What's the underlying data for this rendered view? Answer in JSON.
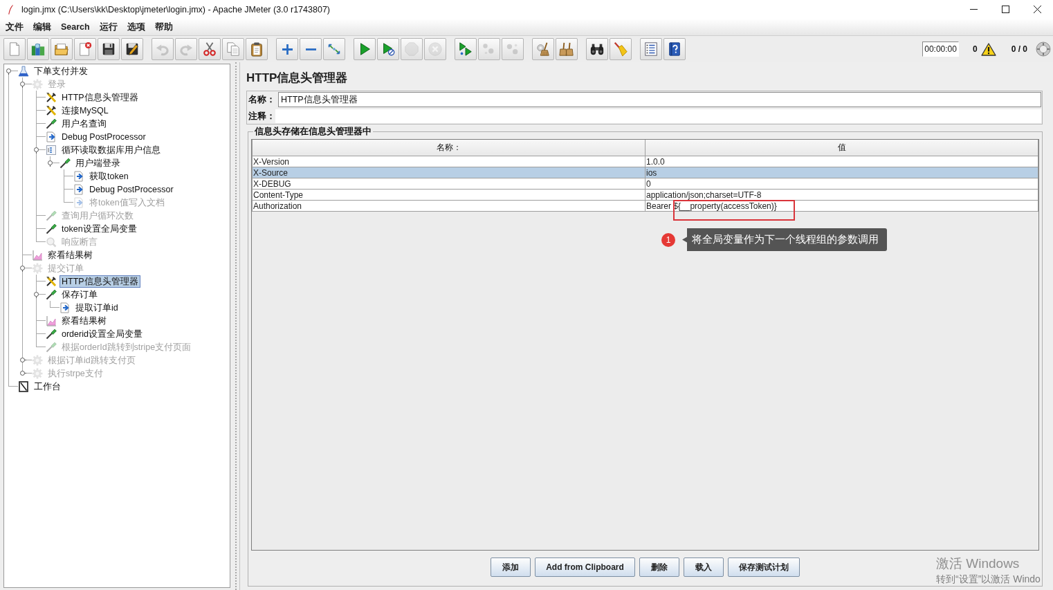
{
  "window": {
    "title": "login.jmx (C:\\Users\\kk\\Desktop\\jmeter\\login.jmx) - Apache JMeter (3.0 r1743807)"
  },
  "menu": [
    "文件",
    "编辑",
    "Search",
    "运行",
    "选项",
    "帮助"
  ],
  "toolbar": {
    "groups": [
      [
        {
          "kind": "new",
          "disabled": false
        },
        {
          "kind": "templates",
          "disabled": false
        },
        {
          "kind": "open",
          "disabled": false
        },
        {
          "kind": "close",
          "disabled": false
        },
        {
          "kind": "save",
          "disabled": false
        },
        {
          "kind": "save-as",
          "disabled": false
        }
      ],
      [
        {
          "kind": "undo",
          "disabled": true
        },
        {
          "kind": "redo",
          "disabled": true
        },
        {
          "kind": "cut",
          "disabled": false
        },
        {
          "kind": "copy",
          "disabled": false
        },
        {
          "kind": "paste",
          "disabled": false
        }
      ],
      [
        {
          "kind": "expand",
          "disabled": false
        },
        {
          "kind": "collapse",
          "disabled": false
        },
        {
          "kind": "toggle",
          "disabled": false
        }
      ],
      [
        {
          "kind": "start",
          "disabled": false
        },
        {
          "kind": "start-no-timers",
          "disabled": false
        },
        {
          "kind": "stop",
          "disabled": true
        },
        {
          "kind": "shutdown",
          "disabled": true
        }
      ],
      [
        {
          "kind": "remote-start",
          "disabled": false
        },
        {
          "kind": "remote-stop",
          "disabled": true
        },
        {
          "kind": "remote-exit",
          "disabled": true
        }
      ],
      [
        {
          "kind": "clear",
          "disabled": false
        },
        {
          "kind": "clear-all",
          "disabled": false
        }
      ],
      [
        {
          "kind": "search",
          "disabled": false
        },
        {
          "kind": "reset-search",
          "disabled": false
        }
      ],
      [
        {
          "kind": "function-helper",
          "disabled": false
        },
        {
          "kind": "help",
          "disabled": false
        }
      ]
    ],
    "timer": "00:00:00",
    "warning_count": "0",
    "thread_counter": "0 / 0"
  },
  "tree": [
    {
      "kind": "test-plan",
      "label": "下单支付并发",
      "disabled": false,
      "selected": false,
      "expanded": true,
      "children": [
        {
          "kind": "thread-group",
          "label": "登录",
          "disabled": true,
          "selected": false,
          "expanded": true,
          "children": [
            {
              "kind": "config",
              "label": "HTTP信息头管理器",
              "disabled": false,
              "selected": false
            },
            {
              "kind": "config",
              "label": "连接MySQL",
              "disabled": false,
              "selected": false
            },
            {
              "kind": "sampler",
              "label": "用户名查询",
              "disabled": false,
              "selected": false
            },
            {
              "kind": "post-processor",
              "label": "Debug PostProcessor",
              "disabled": false,
              "selected": false
            },
            {
              "kind": "controller",
              "label": "循环读取数据库用户信息",
              "disabled": false,
              "selected": false,
              "expanded": true,
              "children": [
                {
                  "kind": "sampler",
                  "label": "用户端登录",
                  "disabled": false,
                  "selected": false,
                  "expanded": true,
                  "children": [
                    {
                      "kind": "post-processor",
                      "label": "获取token",
                      "disabled": false,
                      "selected": false
                    },
                    {
                      "kind": "post-processor",
                      "label": "Debug PostProcessor",
                      "disabled": false,
                      "selected": false
                    },
                    {
                      "kind": "post-processor",
                      "label": "将token值写入文档",
                      "disabled": true,
                      "selected": false
                    }
                  ]
                }
              ]
            },
            {
              "kind": "sampler",
              "label": "查询用户循环次数",
              "disabled": true,
              "selected": false
            },
            {
              "kind": "sampler",
              "label": "token设置全局变量",
              "disabled": false,
              "selected": false
            },
            {
              "kind": "assertion",
              "label": "响应断言",
              "disabled": true,
              "selected": false
            }
          ]
        },
        {
          "kind": "listener",
          "label": "察看结果树",
          "disabled": false,
          "selected": false
        },
        {
          "kind": "thread-group",
          "label": "提交订单",
          "disabled": true,
          "selected": false,
          "expanded": true,
          "children": [
            {
              "kind": "config",
              "label": "HTTP信息头管理器",
              "disabled": false,
              "selected": true
            },
            {
              "kind": "sampler",
              "label": "保存订单",
              "disabled": false,
              "selected": false,
              "expanded": true,
              "children": [
                {
                  "kind": "post-processor",
                  "label": "提取订单id",
                  "disabled": false,
                  "selected": false
                }
              ]
            },
            {
              "kind": "listener",
              "label": "察看结果树",
              "disabled": false,
              "selected": false
            },
            {
              "kind": "sampler",
              "label": "orderid设置全局变量",
              "disabled": false,
              "selected": false
            },
            {
              "kind": "sampler",
              "label": "根据orderId跳转到stripe支付页面",
              "disabled": true,
              "selected": false
            }
          ]
        },
        {
          "kind": "thread-group",
          "label": "根据订单id跳转支付页",
          "disabled": true,
          "selected": false,
          "expanded": false
        },
        {
          "kind": "thread-group",
          "label": "执行strpe支付",
          "disabled": true,
          "selected": false,
          "expanded": false
        }
      ]
    },
    {
      "kind": "workbench",
      "label": "工作台",
      "disabled": false,
      "selected": false
    }
  ],
  "editor": {
    "title": "HTTP信息头管理器",
    "name_label": "名称：",
    "name_value": "HTTP信息头管理器",
    "comment_label": "注释：",
    "group_title": "信息头存储在信息头管理器中",
    "table": {
      "columns": [
        "名称：",
        "值"
      ],
      "rows": [
        {
          "name": "X-Version",
          "value": "1.0.0",
          "selected": false,
          "highlighted": false
        },
        {
          "name": "X-Source",
          "value": "ios",
          "selected": true,
          "highlighted": false
        },
        {
          "name": "X-DEBUG",
          "value": "0",
          "selected": false,
          "highlighted": false
        },
        {
          "name": "Content-Type",
          "value": "application/json;charset=UTF-8",
          "selected": false,
          "highlighted": false
        },
        {
          "name": "Authorization",
          "value": "Bearer ${__property(accessToken)}",
          "selected": false,
          "highlighted": true
        }
      ]
    },
    "buttons": [
      "添加",
      "Add from Clipboard",
      "删除",
      "载入",
      "保存测试计划"
    ]
  },
  "annotation": {
    "marker": "1",
    "text": "将全局变量作为下一个线程组的参数调用"
  },
  "activation_notice": {
    "title": "激活 Windows",
    "hint": "转到“设置”以激活 Windo"
  }
}
